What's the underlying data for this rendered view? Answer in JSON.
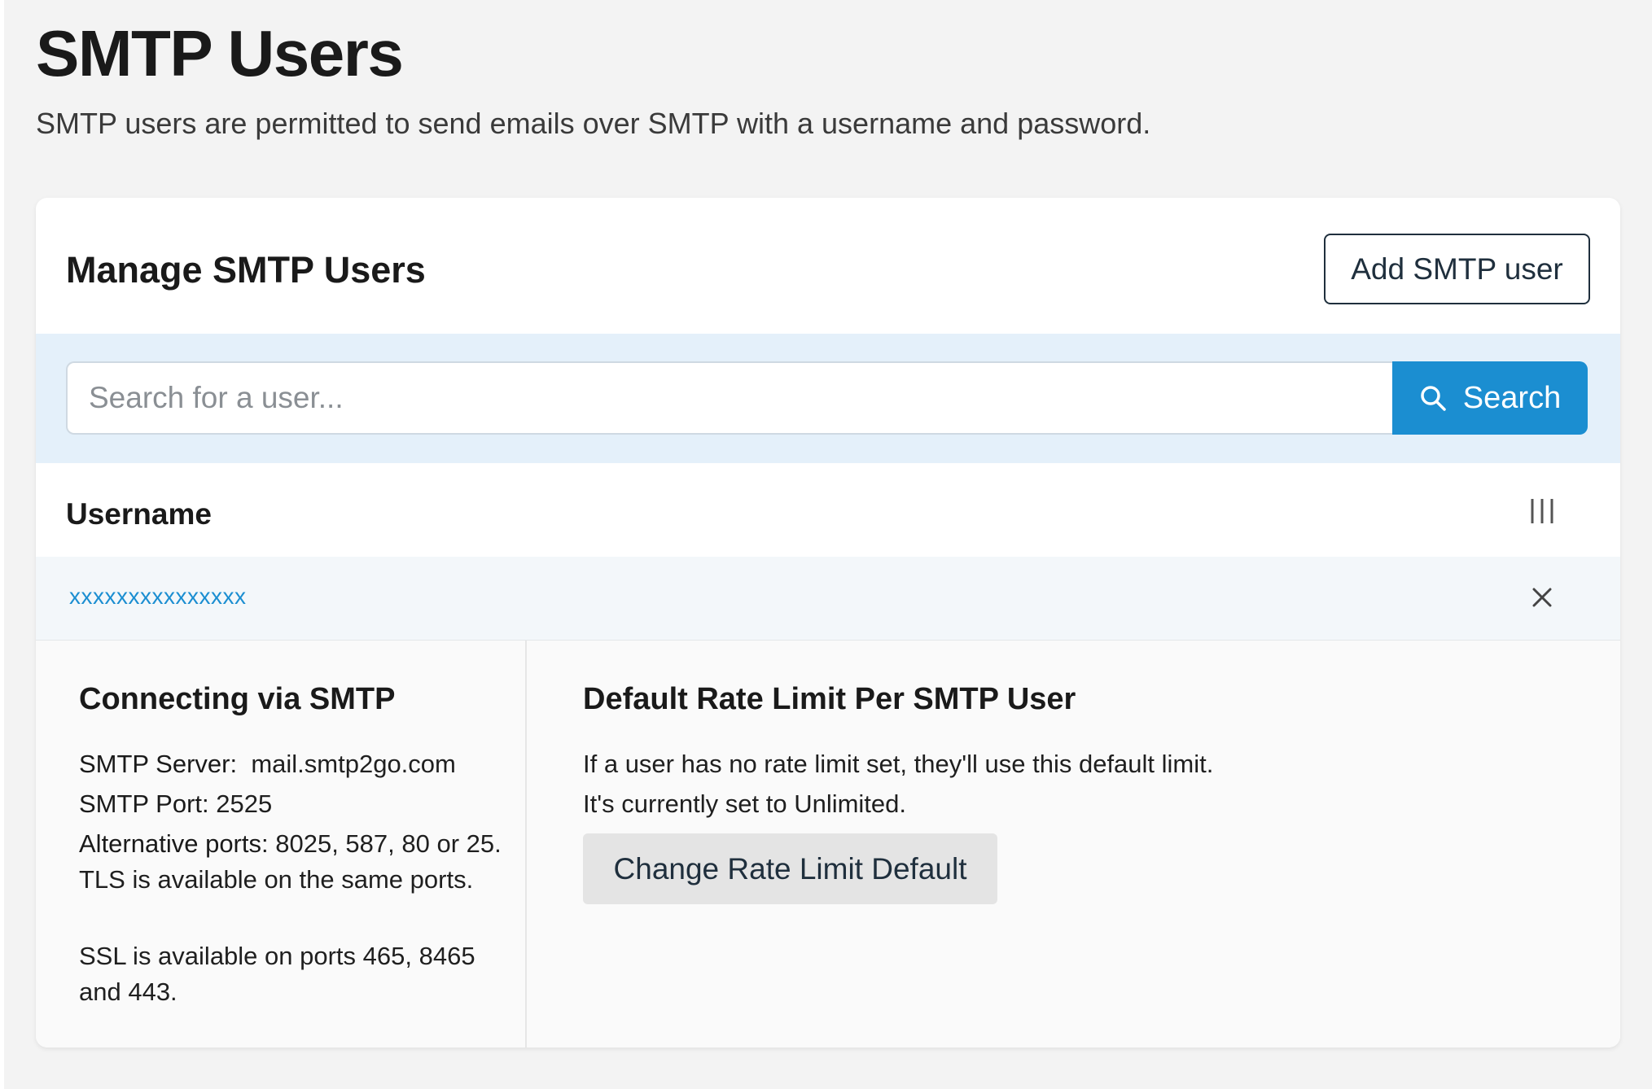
{
  "page": {
    "title": "SMTP Users",
    "subtitle": "SMTP users are permitted to send emails over SMTP with a username and password."
  },
  "card": {
    "title": "Manage SMTP Users",
    "add_button_label": "Add SMTP user"
  },
  "search": {
    "placeholder": "Search for a user...",
    "button_label": "Search",
    "icon": "search-icon"
  },
  "table": {
    "columns": [
      "Username"
    ],
    "columns_toggle_icon": "columns-icon",
    "rows": [
      {
        "username": "xxxxxxxxxxxxxxx",
        "remove_icon": "close-icon"
      }
    ]
  },
  "connection": {
    "title": "Connecting via SMTP",
    "server_label": "SMTP Server:",
    "server_value": "mail.smtp2go.com",
    "port_label": "SMTP Port:",
    "port_value": "2525",
    "alt_ports_label": "Alternative ports:",
    "alt_ports_text": "8025, 587, 80 or 25. TLS is available on the same ports.",
    "ssl_text": "SSL is available on ports 465, 8465 and 443."
  },
  "rate_limit": {
    "title": "Default Rate Limit Per SMTP User",
    "description": "If a user has no rate limit set, they'll use this default limit.",
    "current_prefix": "It's currently set to",
    "current_value": "Unlimited",
    "current_suffix": ".",
    "button_label": "Change Rate Limit Default"
  },
  "colors": {
    "accent": "#1b8ed1",
    "search_band": "#e4f0fa",
    "page_bg": "#f3f3f3"
  }
}
